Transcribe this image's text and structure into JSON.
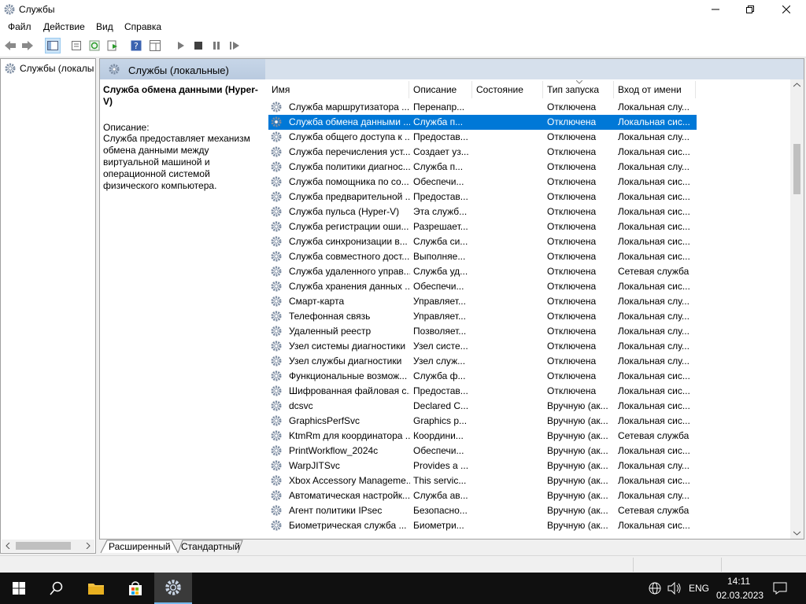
{
  "window": {
    "title": "Службы"
  },
  "menu": [
    "Файл",
    "Действие",
    "Вид",
    "Справка"
  ],
  "tree": {
    "item": "Службы (локалы"
  },
  "panel": {
    "header": "Службы (локальные)",
    "selected_title": "Служба обмена данными (Hyper-V)",
    "desc_label": "Описание:",
    "desc_text": "Служба предоставляет механизм обмена данными между виртуальной машиной и операционной системой физического компьютера."
  },
  "columns": [
    "Имя",
    "Описание",
    "Состояние",
    "Тип запуска",
    "Вход от имени"
  ],
  "rows": [
    [
      "Служба маршрутизатора ...",
      "Перенапр...",
      "",
      "Отключена",
      "Локальная слу..."
    ],
    [
      "Служба обмена данными ...",
      "Служба п...",
      "",
      "Отключена",
      "Локальная сис..."
    ],
    [
      "Служба общего доступа к ...",
      "Предостав...",
      "",
      "Отключена",
      "Локальная слу..."
    ],
    [
      "Служба перечисления уст...",
      "Создает уз...",
      "",
      "Отключена",
      "Локальная сис..."
    ],
    [
      "Служба политики диагнос...",
      "Служба п...",
      "",
      "Отключена",
      "Локальная слу..."
    ],
    [
      "Служба помощника по со...",
      "Обеспечи...",
      "",
      "Отключена",
      "Локальная сис..."
    ],
    [
      "Служба предварительной ...",
      "Предостав...",
      "",
      "Отключена",
      "Локальная сис..."
    ],
    [
      "Служба пульса (Hyper-V)",
      "Эта служб...",
      "",
      "Отключена",
      "Локальная сис..."
    ],
    [
      "Служба регистрации оши...",
      "Разрешает...",
      "",
      "Отключена",
      "Локальная сис..."
    ],
    [
      "Служба синхронизации в...",
      "Служба си...",
      "",
      "Отключена",
      "Локальная сис..."
    ],
    [
      "Служба совместного дост...",
      "Выполняе...",
      "",
      "Отключена",
      "Локальная сис..."
    ],
    [
      "Служба удаленного управ...",
      "Служба уд...",
      "",
      "Отключена",
      "Сетевая служба"
    ],
    [
      "Служба хранения данных ...",
      "Обеспечи...",
      "",
      "Отключена",
      "Локальная сис..."
    ],
    [
      "Смарт-карта",
      "Управляет...",
      "",
      "Отключена",
      "Локальная слу..."
    ],
    [
      "Телефонная связь",
      "Управляет...",
      "",
      "Отключена",
      "Локальная слу..."
    ],
    [
      "Удаленный реестр",
      "Позволяет...",
      "",
      "Отключена",
      "Локальная слу..."
    ],
    [
      "Узел системы диагностики",
      "Узел систе...",
      "",
      "Отключена",
      "Локальная слу..."
    ],
    [
      "Узел службы диагностики",
      "Узел служ...",
      "",
      "Отключена",
      "Локальная слу..."
    ],
    [
      "Функциональные возмож...",
      "Служба ф...",
      "",
      "Отключена",
      "Локальная сис..."
    ],
    [
      "Шифрованная файловая с...",
      "Предостав...",
      "",
      "Отключена",
      "Локальная сис..."
    ],
    [
      "dcsvc",
      "Declared C...",
      "",
      "Вручную (ак...",
      "Локальная сис..."
    ],
    [
      "GraphicsPerfSvc",
      "Graphics p...",
      "",
      "Вручную (ак...",
      "Локальная сис..."
    ],
    [
      "KtmRm для координатора ...",
      "Координи...",
      "",
      "Вручную (ак...",
      "Сетевая служба"
    ],
    [
      "PrintWorkflow_2024c",
      "Обеспечи...",
      "",
      "Вручную (ак...",
      "Локальная сис..."
    ],
    [
      "WarpJITSvc",
      "Provides a ...",
      "",
      "Вручную (ак...",
      "Локальная слу..."
    ],
    [
      "Xbox Accessory Manageme...",
      "This servic...",
      "",
      "Вручную (ак...",
      "Локальная сис..."
    ],
    [
      "Автоматическая настройк...",
      "Служба ав...",
      "",
      "Вручную (ак...",
      "Локальная слу..."
    ],
    [
      "Агент политики IPsec",
      "Безопасно...",
      "",
      "Вручную (ак...",
      "Сетевая служба"
    ],
    [
      "Биометрическая служба ...",
      "Биометри...",
      "",
      "Вручную (ак...",
      "Локальная сис..."
    ]
  ],
  "selected_row": 1,
  "tabs": [
    "Расширенный",
    "Стандартный"
  ],
  "tray": {
    "lang": "ENG",
    "time": "14:11",
    "date": "02.03.2023"
  }
}
